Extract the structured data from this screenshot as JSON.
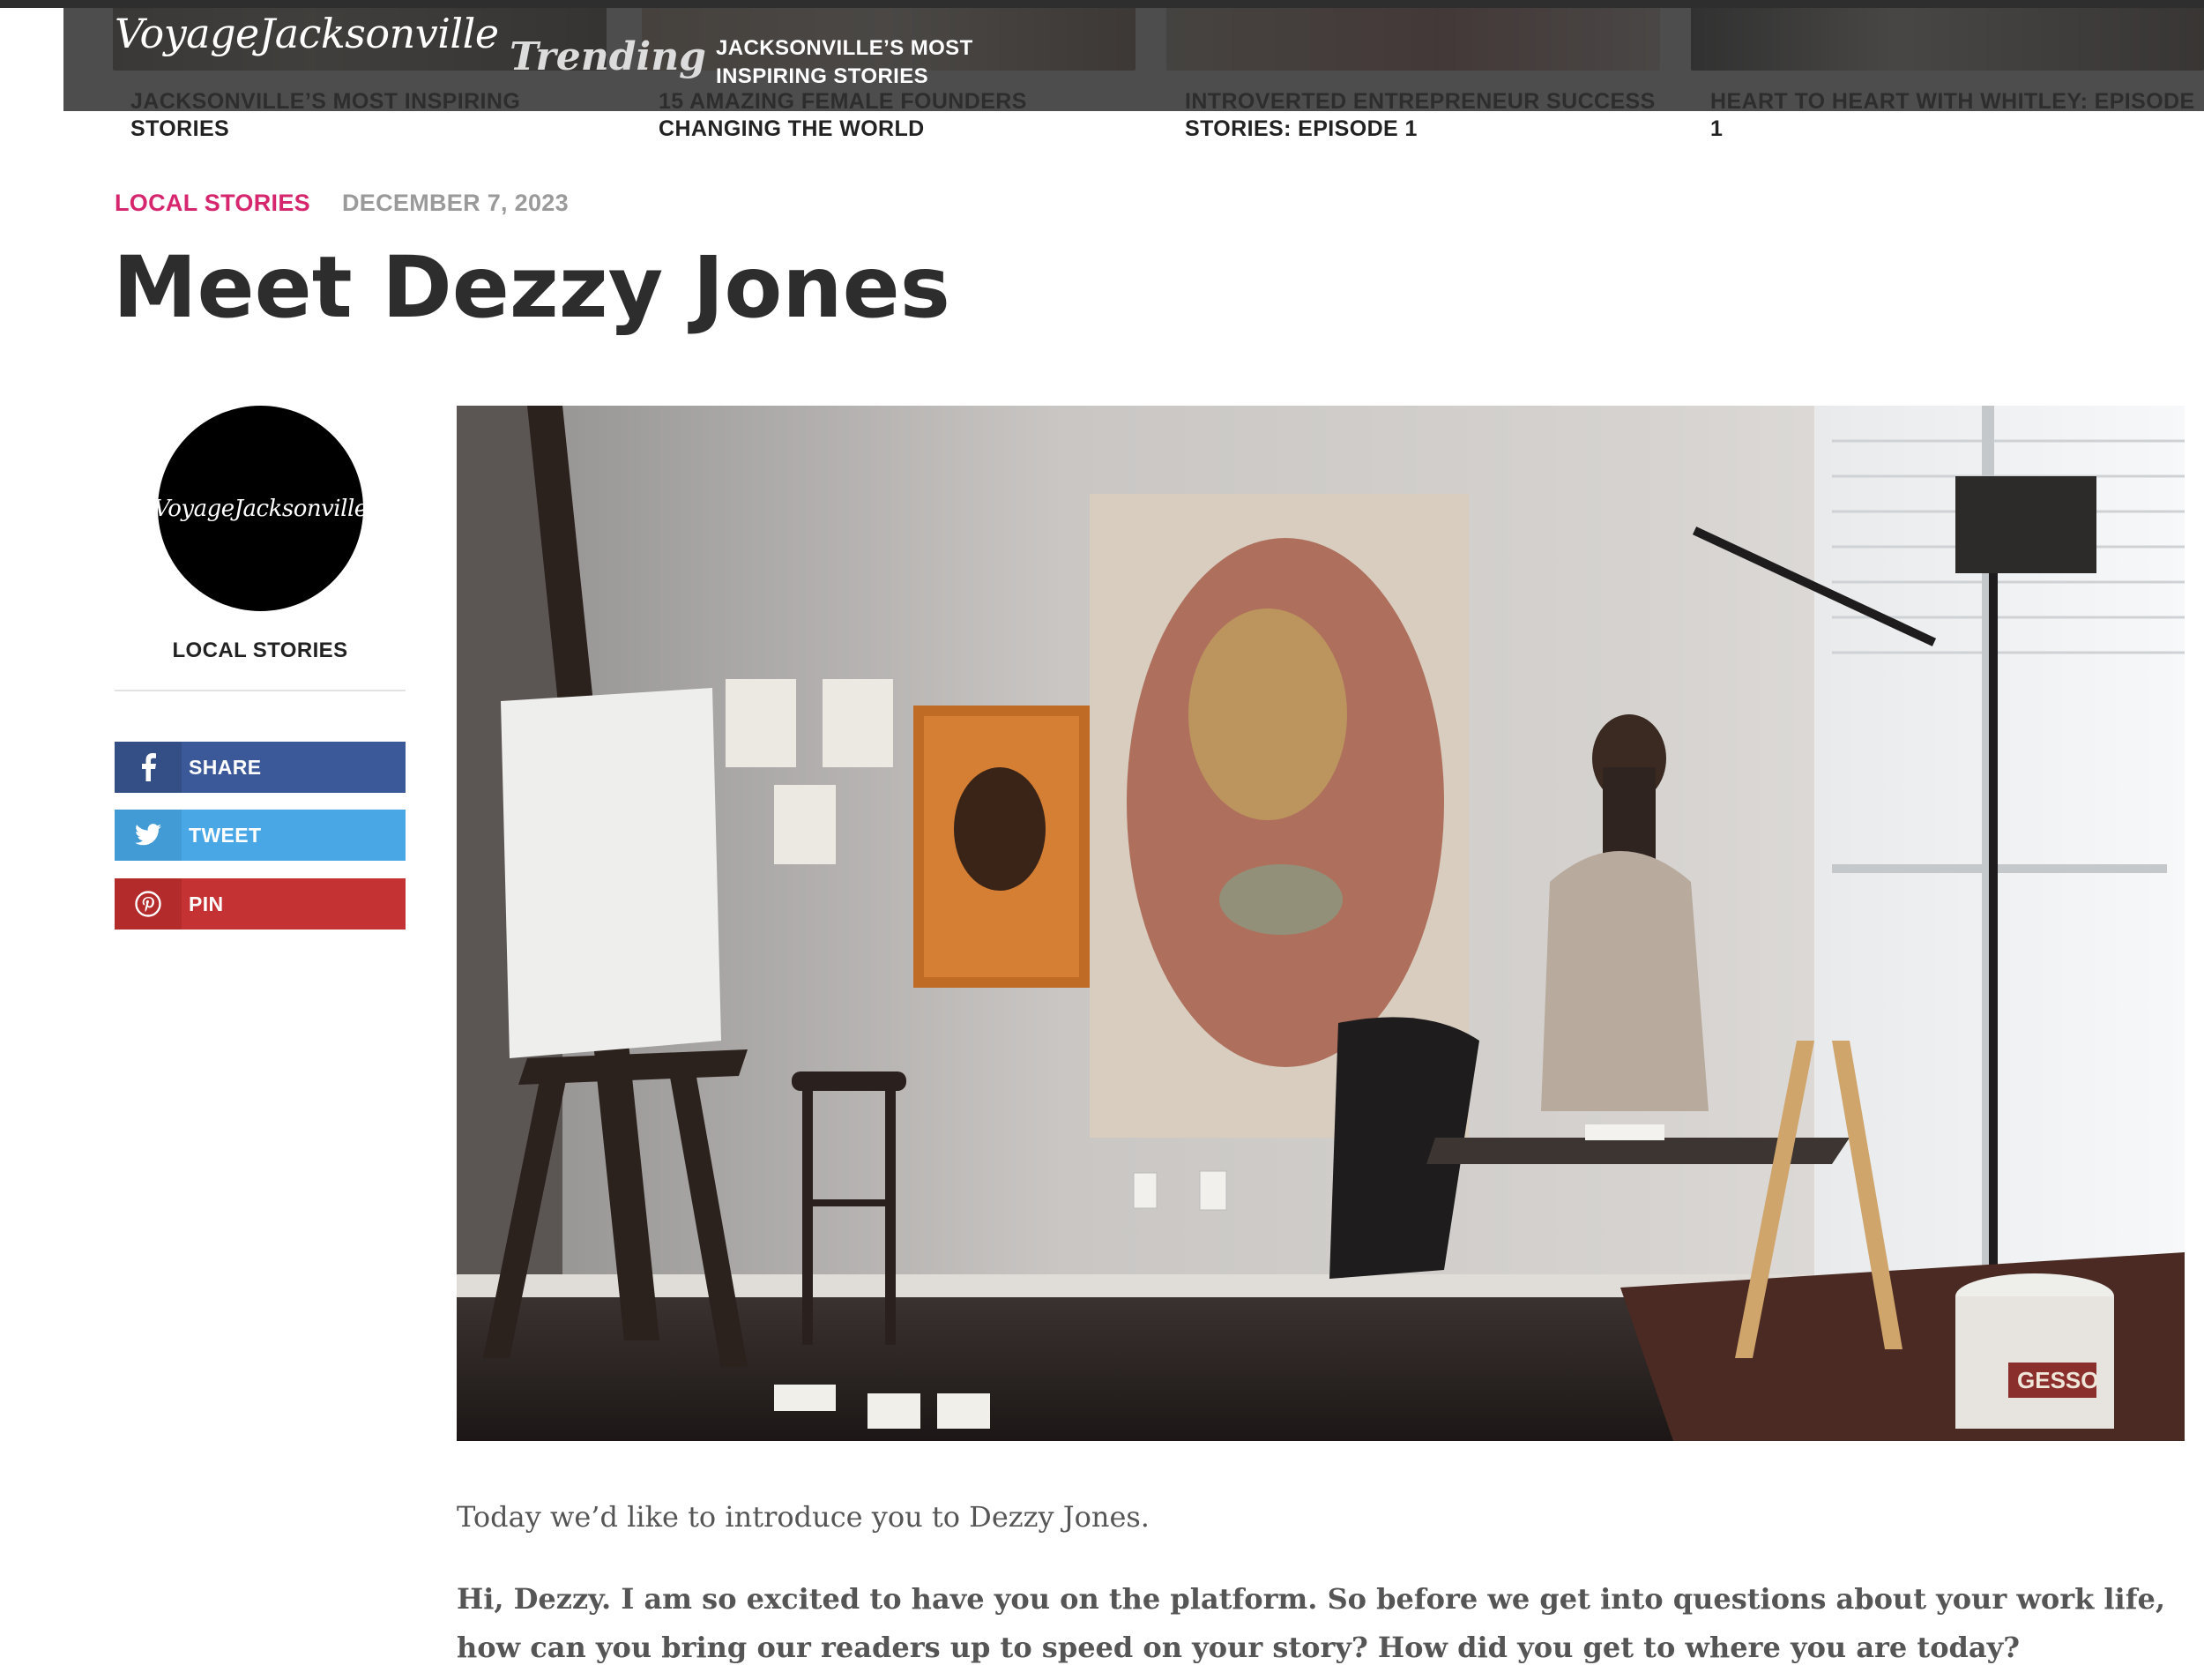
{
  "site": {
    "logo": "VoyageJacksonville"
  },
  "trending": {
    "label": "Trending",
    "items": [
      {
        "title": "JACKSONVILLE’S MOST INSPIRING STORIES"
      },
      {
        "title": "15 AMAZING FEMALE FOUNDERS CHANGING THE WORLD"
      },
      {
        "title": "INTROVERTED ENTREPRENEUR SUCCESS STORIES: EPISODE 1"
      },
      {
        "title": "HEART TO HEART WITH WHITLEY: EPISODE 1"
      }
    ]
  },
  "article": {
    "category": "LOCAL STORIES",
    "date": "DECEMBER 7, 2023",
    "title": "Meet Dezzy Jones",
    "intro": "Today we’d like to introduce you to Dezzy Jones.",
    "question": "Hi, Dezzy. I am so excited to have you on the platform. So before we get into questions about your work life, how can you bring our readers up to speed on your story? How did you get to where you are today?"
  },
  "sidebar": {
    "avatar_text": "VoyageJacksonville",
    "category": "LOCAL STORIES",
    "share": [
      {
        "label": "SHARE",
        "icon": "facebook-icon",
        "color": "#3b5998"
      },
      {
        "label": "TWEET",
        "icon": "twitter-icon",
        "color": "#4aa7e6"
      },
      {
        "label": "PIN",
        "icon": "pinterest-icon",
        "color": "#c53233"
      }
    ]
  },
  "photo": {
    "gesso_label": "GESSO"
  },
  "colors": {
    "accent": "#d6266e",
    "header_bg": "#303030"
  }
}
